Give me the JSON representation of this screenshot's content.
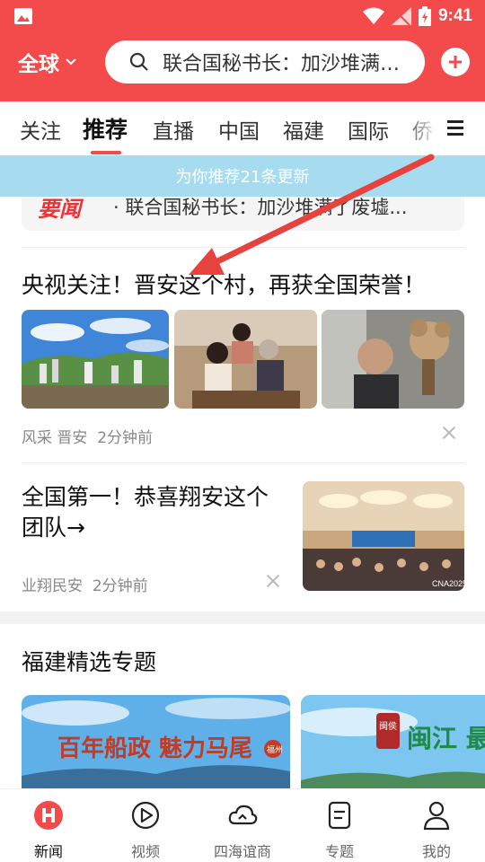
{
  "status_bar": {
    "time": "9:41"
  },
  "header": {
    "region_label": "全球",
    "search_text": "联合国秘书长：加沙堆满…",
    "colors": {
      "brand": "#f34a4c"
    }
  },
  "tabs": [
    {
      "label": "关注"
    },
    {
      "label": "推荐"
    },
    {
      "label": "直播"
    },
    {
      "label": "中国"
    },
    {
      "label": "福建"
    },
    {
      "label": "国际"
    },
    {
      "label": "侨"
    }
  ],
  "banner": {
    "text": "为你推荐21条更新"
  },
  "partial_card": {
    "tag": "要闻",
    "text": "· 联合国秘书长：加沙堆满了废墟..."
  },
  "articles": [
    {
      "title": "央视关注！晋安这个村，再获全国荣誉！",
      "source": "风采 晋安",
      "time": "2分钟前"
    },
    {
      "title": "全国第一！恭喜翔安这个团队→",
      "source": "业翔民安",
      "time": "2分钟前",
      "image_watermark": "CNA2025"
    }
  ],
  "section": {
    "title": "福建精选专题",
    "cards": [
      {
        "art_text": "百年船政 魅力马尾",
        "stamp": "福州"
      },
      {
        "art_text": "闽江 最美的闽",
        "stamp": "闽侯"
      }
    ]
  },
  "bottom_nav": [
    {
      "label": "新闻",
      "icon": "news-icon"
    },
    {
      "label": "视频",
      "icon": "play-icon"
    },
    {
      "label": "四海谊商",
      "icon": "cloud-icon"
    },
    {
      "label": "专题",
      "icon": "document-icon"
    },
    {
      "label": "我的",
      "icon": "person-icon"
    }
  ]
}
